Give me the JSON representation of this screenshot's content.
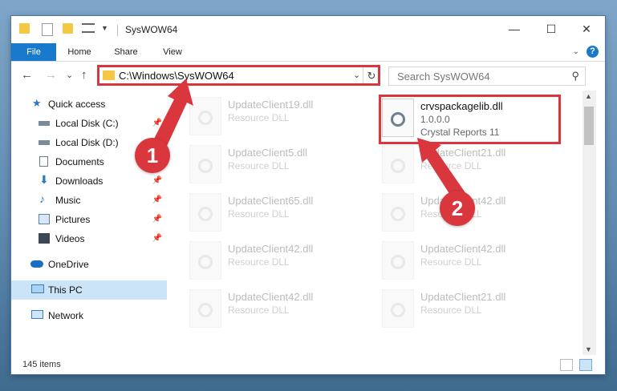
{
  "window": {
    "title": "SysWOW64",
    "caption": {
      "minimize": "—",
      "maximize": "☐",
      "close": "✕"
    }
  },
  "ribbon": {
    "tabs": [
      {
        "label": "File"
      },
      {
        "label": "Home"
      },
      {
        "label": "Share"
      },
      {
        "label": "View"
      }
    ],
    "help": "?",
    "expand": "⌄"
  },
  "nav": {
    "back": "←",
    "forward": "→",
    "recent": "⌄",
    "up": "↑",
    "address": "C:\\Windows\\SysWOW64",
    "address_drop": "⌄",
    "refresh": "↻",
    "search_placeholder": "Search SysWOW64",
    "search_icon": "⚲"
  },
  "sidebar": {
    "items": [
      {
        "label": "Quick access",
        "icon": "star-icon",
        "pinned": false
      },
      {
        "label": "Local Disk (C:)",
        "icon": "drive-icon",
        "pinned": true
      },
      {
        "label": "Local Disk (D:)",
        "icon": "drive-icon",
        "pinned": true
      },
      {
        "label": "Documents",
        "icon": "documents-icon",
        "pinned": true
      },
      {
        "label": "Downloads",
        "icon": "download-icon",
        "pinned": true
      },
      {
        "label": "Music",
        "icon": "music-icon",
        "pinned": true
      },
      {
        "label": "Pictures",
        "icon": "pictures-icon",
        "pinned": true
      },
      {
        "label": "Videos",
        "icon": "videos-icon",
        "pinned": true
      },
      {
        "label": "OneDrive",
        "icon": "cloud-icon",
        "pinned": false
      },
      {
        "label": "This PC",
        "icon": "computer-icon",
        "pinned": false,
        "selected": true
      },
      {
        "label": "Network",
        "icon": "network-icon",
        "pinned": false
      }
    ],
    "pin_glyph": "📌"
  },
  "files": {
    "left": [
      {
        "name": "UpdateClient19.dll",
        "type": "Resource DLL"
      },
      {
        "name": "UpdateClient5.dll",
        "type": "Resource DLL"
      },
      {
        "name": "UpdateClient65.dll",
        "type": "Resource DLL"
      },
      {
        "name": "UpdateClient42.dll",
        "type": "Resource DLL"
      },
      {
        "name": "UpdateClient42.dll",
        "type": "Resource DLL"
      }
    ],
    "right": [
      {
        "name": "crvspackagelib.dll",
        "type": "1.0.0.0",
        "sub": "Crystal Reports 11"
      },
      {
        "name": "UpdateClient21.dll",
        "type": "Resource DLL"
      },
      {
        "name": "UpdateClient42.dll",
        "type": "Resource DLL"
      },
      {
        "name": "UpdateClient42.dll",
        "type": "Resource DLL"
      },
      {
        "name": "UpdateClient21.dll",
        "type": "Resource DLL"
      }
    ]
  },
  "status": {
    "item_count": "145 items"
  },
  "callouts": {
    "one": "1",
    "two": "2"
  },
  "colors": {
    "accent": "#1979ca",
    "highlight": "#d9363e",
    "selected": "#cce4f7"
  }
}
